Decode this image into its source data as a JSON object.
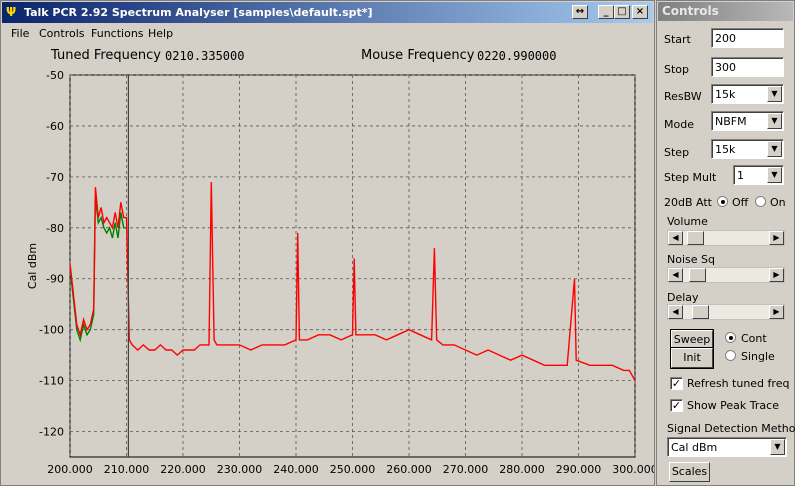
{
  "main_window": {
    "title": "Talk PCR 2.92 Spectrum Analyser [samples\\default.spt*]",
    "title_buttons": {
      "restore": "↔",
      "minimize": "_",
      "maximize": "□",
      "close": "×"
    }
  },
  "menu": {
    "items": [
      "File",
      "Controls",
      "Functions",
      "Help"
    ]
  },
  "readouts": {
    "tuned_label": "Tuned Frequency",
    "tuned_value": "0210.335000",
    "mouse_label": "Mouse Frequency",
    "mouse_value": "0220.990000"
  },
  "chart_data": {
    "type": "line",
    "ylabel": "Cal dBm",
    "xlabel": "",
    "title": "",
    "xlim": [
      200,
      300
    ],
    "ylim": [
      -125,
      -50
    ],
    "x_ticks": [
      "200.000",
      "210.000",
      "220.000",
      "230.000",
      "240.000",
      "250.000",
      "260.000",
      "270.000",
      "280.000",
      "290.000",
      "300.000"
    ],
    "y_ticks": [
      "-50",
      "-60",
      "-70",
      "-80",
      "-90",
      "-100",
      "-110",
      "-120"
    ],
    "grid": true,
    "tuned_marker_x": 210.335,
    "series": [
      {
        "color": "#ff0000",
        "x": [
          200.0,
          200.6,
          201.2,
          201.8,
          202.4,
          203.0,
          203.6,
          204.2,
          204.5,
          205.0,
          205.5,
          206.0,
          206.5,
          207.0,
          207.5,
          208.0,
          208.5,
          209.0,
          209.5,
          210.0,
          210.5,
          211.0,
          212.0,
          213.0,
          214.0,
          215.0,
          216.0,
          217.0,
          218.0,
          219.0,
          220.0,
          221.0,
          222.0,
          223.0,
          224.0,
          224.6,
          225.0,
          225.5,
          226.0,
          227.0,
          228.0,
          230.0,
          232.0,
          234.0,
          236.0,
          238.0,
          240.0,
          240.3,
          240.6,
          242.0,
          244.0,
          246.0,
          248.0,
          250.0,
          250.3,
          250.6,
          252.0,
          254.0,
          256.0,
          258.0,
          260.0,
          262.0,
          264.0,
          264.5,
          264.9,
          266.0,
          268.0,
          270.0,
          272.0,
          274.0,
          276.0,
          278.0,
          280.0,
          282.0,
          284.0,
          286.0,
          288.0,
          289.3,
          289.6,
          292.0,
          294.0,
          296.0,
          298.0,
          299.0,
          300.0
        ],
        "y": [
          -87,
          -93,
          -99,
          -101,
          -98,
          -100,
          -99,
          -96,
          -72,
          -78,
          -76,
          -79,
          -78,
          -79,
          -80,
          -77,
          -80,
          -75,
          -78,
          -78,
          -102,
          -103,
          -104,
          -103,
          -104,
          -104,
          -103,
          -104,
          -104,
          -105,
          -104,
          -104,
          -104,
          -103,
          -103,
          -103,
          -71,
          -102,
          -103,
          -103,
          -103,
          -103,
          -104,
          -103,
          -103,
          -103,
          -102,
          -81,
          -102,
          -102,
          -101,
          -101,
          -102,
          -101,
          -86,
          -101,
          -101,
          -101,
          -102,
          -101,
          -100,
          -101,
          -102,
          -84,
          -102,
          -103,
          -103,
          -104,
          -105,
          -104,
          -105,
          -106,
          -105,
          -106,
          -107,
          -107,
          -107,
          -90,
          -106,
          -107,
          -107,
          -107,
          -108,
          -108,
          -110
        ]
      },
      {
        "color": "#008000",
        "x": [
          200.0,
          200.6,
          201.2,
          201.8,
          202.4,
          203.0,
          203.6,
          204.2,
          204.5,
          205.0,
          205.5,
          206.0,
          206.5,
          207.0,
          207.5,
          208.0,
          208.5,
          209.0,
          209.5,
          210.0
        ],
        "y": [
          -88,
          -94,
          -100,
          -102,
          -99,
          -101,
          -100,
          -97,
          -74,
          -79,
          -78,
          -80,
          -81,
          -80,
          -82,
          -79,
          -82,
          -77,
          -80,
          -80
        ]
      }
    ]
  },
  "controls": {
    "title": "Controls",
    "start_label": "Start",
    "start_value": "200",
    "stop_label": "Stop",
    "stop_value": "300",
    "resbw_label": "ResBW",
    "resbw_value": "15k",
    "mode_label": "Mode",
    "mode_value": "NBFM",
    "step_label": "Step",
    "step_value": "15k",
    "stepmult_label": "Step Mult",
    "stepmult_value": "1",
    "att_label": "20dB Att",
    "att_off": "Off",
    "att_on": "On",
    "volume_label": "Volume",
    "noisesq_label": "Noise Sq",
    "delay_label": "Delay",
    "sweep_button": "Sweep",
    "init_button": "Init",
    "cont_label": "Cont",
    "single_label": "Single",
    "refresh_label": "Refresh tuned freq",
    "peak_label": "Show Peak Trace",
    "detect_label": "Signal Detection Method",
    "detect_value": "Cal dBm",
    "scales_button": "Scales",
    "volume_level": 0.05,
    "noisesq_level": 0.08,
    "delay_level": 0.12
  }
}
